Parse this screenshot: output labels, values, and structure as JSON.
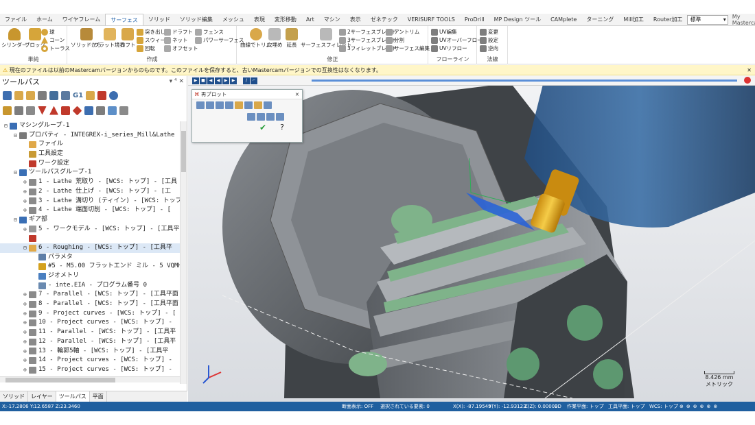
{
  "ribbon_tabs": [
    "ファイル",
    "ホーム",
    "ワイヤフレーム",
    "サーフェス",
    "ソリッド",
    "ソリッド編集",
    "メッシュ",
    "表現",
    "変形移動",
    "Art",
    "マシン",
    "表示",
    "ゼネテック",
    "VERISURF TOOLS",
    "ProDrill",
    "MP Design ツール",
    "CAMplete",
    "ターニング",
    "Mill加工",
    "Router加工"
  ],
  "active_tab": "サーフェス",
  "right_controls": {
    "style_combo": "標準",
    "account": "My Mastercam"
  },
  "ribbon": {
    "basic": {
      "label": "単純",
      "items": [
        "シリンダー",
        "ブロック",
        "球",
        "コーン",
        "トーラス"
      ]
    },
    "create": {
      "label": "作成",
      "items": [
        "ソリッドから",
        "フラット境界",
        "ロフト",
        "突き出し",
        "スウィープ",
        "回転",
        "ドラフト",
        "ネット",
        "オフセット",
        "フェンス",
        "パワーサーフェス"
      ]
    },
    "modify": {
      "label": "修正",
      "items": [
        "曲線でトリム",
        "穴埋め",
        "延長",
        "サーフェスフィレット",
        "2サーフェスブレンド",
        "3サーフェスブレンド",
        "3フィレットブレンド",
        "アントリム",
        "分割",
        "サーフェス編集"
      ]
    },
    "flowline": {
      "label": "フローライン",
      "items": [
        "UV編集",
        "UVオーバーフロー",
        "UVリフロー"
      ]
    },
    "normal": {
      "label": "法線",
      "items": [
        "変更",
        "設定",
        "逆向"
      ]
    }
  },
  "warning": "現在のファイルは以前のMastercamバージョンからのものです。このファイルを保存すると、古いMastercamバージョンでの互換性はなくなります。",
  "panel": {
    "title": "ツールパス",
    "pin": "▾ ⁴ ✕",
    "tree": [
      {
        "text": "マシングループ-1",
        "indent": 0,
        "exp": "⊟",
        "color": "#3a6fb5"
      },
      {
        "text": "プロパティ - INTEGREX-i_series_Mill&Lathe",
        "indent": 1,
        "exp": "⊟",
        "color": "#7a7a7a"
      },
      {
        "text": "ファイル",
        "indent": 2,
        "exp": "",
        "color": "#e0a848"
      },
      {
        "text": "工具設定",
        "indent": 2,
        "exp": "",
        "color": "#c89a34"
      },
      {
        "text": "ワーク設定",
        "indent": 2,
        "exp": "",
        "color": "#c0392b"
      },
      {
        "text": "ツールパスグループ-1",
        "indent": 1,
        "exp": "⊟",
        "color": "#3a6fb5"
      },
      {
        "text": "1 - Lathe 荒取り - [WCS: トップ] - [工具",
        "indent": 2,
        "exp": "⊕",
        "color": "#8a8a8a"
      },
      {
        "text": "2 - Lathe 仕上げ - [WCS: トップ] - [工",
        "indent": 2,
        "exp": "⊕",
        "color": "#8a8a8a"
      },
      {
        "text": "3 - Lathe 溝切り (ティイン) - [WCS: トップ",
        "indent": 2,
        "exp": "⊕",
        "color": "#8a8a8a"
      },
      {
        "text": "4 - Lathe 端面切削 - [WCS: トップ] - [",
        "indent": 2,
        "exp": "⊕",
        "color": "#8a8a8a"
      },
      {
        "text": "ギア部",
        "indent": 1,
        "exp": "⊟",
        "color": "#3a6fb5"
      },
      {
        "text": "5 - ワークモデル - [WCS: トップ] - [工具平",
        "indent": 2,
        "exp": "⊕",
        "color": "#9a9a9a"
      },
      {
        "text": "",
        "indent": 2,
        "exp": "",
        "color": "#c0392b"
      },
      {
        "text": "6 - Roughing - [WCS: トップ] - [工具平",
        "indent": 2,
        "exp": "⊟",
        "color": "#e0a848",
        "sel": true
      },
      {
        "text": "パラメタ",
        "indent": 3,
        "exp": "",
        "color": "#5f7fa8"
      },
      {
        "text": "#5 - M5.00 フラットエンド ミル - 5 VQMH",
        "indent": 3,
        "exp": "",
        "color": "#d4a11e"
      },
      {
        "text": "ジオメトリ",
        "indent": 3,
        "exp": "",
        "color": "#4a7fc0"
      },
      {
        "text": "- inte.EIA - プログラム番号 0",
        "indent": 3,
        "exp": "",
        "color": "#6a8ab0"
      },
      {
        "text": "7 - Parallel - [WCS: トップ] - [工具平面",
        "indent": 2,
        "exp": "⊕",
        "color": "#8a8a8a"
      },
      {
        "text": "8 - Parallel - [WCS: トップ] - [工具平面",
        "indent": 2,
        "exp": "⊕",
        "color": "#8a8a8a"
      },
      {
        "text": "9 - Project curves - [WCS: トップ] - [",
        "indent": 2,
        "exp": "⊕",
        "color": "#8a8a8a"
      },
      {
        "text": "10 - Project curves - [WCS: トップ] -",
        "indent": 2,
        "exp": "⊕",
        "color": "#8a8a8a"
      },
      {
        "text": "11 - Parallel - [WCS: トップ] - [工具平",
        "indent": 2,
        "exp": "⊕",
        "color": "#8a8a8a"
      },
      {
        "text": "12 - Parallel - [WCS: トップ] - [工具平",
        "indent": 2,
        "exp": "⊕",
        "color": "#8a8a8a"
      },
      {
        "text": "13 - 輪郭5軸 - [WCS: トップ] - [工具平",
        "indent": 2,
        "exp": "⊕",
        "color": "#8a8a8a"
      },
      {
        "text": "14 - Project curves - [WCS: トップ] -",
        "indent": 2,
        "exp": "⊕",
        "color": "#8a8a8a"
      },
      {
        "text": "15 - Project curves - [WCS: トップ] -",
        "indent": 2,
        "exp": "⊕",
        "color": "#8a8a8a"
      }
    ]
  },
  "bottom_tabs": [
    "ソリッド",
    "レイヤー",
    "ツールパス",
    "平面"
  ],
  "active_bottom_tab": "ツールパス",
  "playback": {
    "title": "再プロット",
    "close": "×"
  },
  "scale": {
    "value": "8.426 mm",
    "unit": "メトリック"
  },
  "status": {
    "coords": "X:-17.2806  Y:12.6587  Z:23.3460",
    "section": "断面表示: OFF",
    "selected": "選択されている要素: 0",
    "x": "X(X): -87.19549",
    "y": "Y(Y): -12.93123",
    "z": "Z(Z): 0.00000",
    "dim": "3D",
    "cplane": "作業平面: トップ",
    "tplane": "工具平面: トップ",
    "wcs": "WCS: トップ"
  },
  "colors": {
    "accent": "#1f5fa8",
    "status": "#1f5f9f",
    "warn": "#fff6c8",
    "tool_body": "#1c4a7a",
    "tool_tip": "#e8b020",
    "part": "#6c7075",
    "green": "#7fb38a"
  }
}
